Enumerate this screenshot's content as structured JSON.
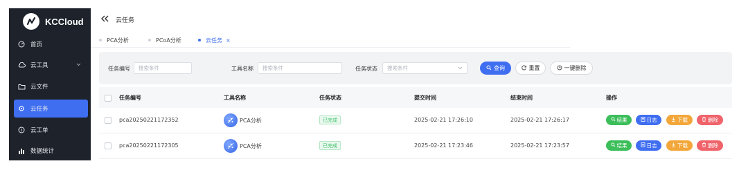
{
  "app": {
    "name": "KCCloud"
  },
  "sidebar": {
    "items": [
      {
        "label": "首页",
        "icon": "dashboard-icon",
        "active": false
      },
      {
        "label": "云工具",
        "icon": "cloud-icon",
        "active": false,
        "has_caret": true
      },
      {
        "label": "云文件",
        "icon": "folder-icon",
        "active": false
      },
      {
        "label": "云任务",
        "icon": "gear-icon",
        "active": true
      },
      {
        "label": "云工单",
        "icon": "info-icon",
        "active": false
      },
      {
        "label": "数据统计",
        "icon": "bar-chart-icon",
        "active": false
      }
    ]
  },
  "header": {
    "breadcrumb": "云任务",
    "collapse_icon": "double-chevron-left-icon"
  },
  "tabs": [
    {
      "label": "PCA分析",
      "active": false
    },
    {
      "label": "PCoA分析",
      "active": false
    },
    {
      "label": "云任务",
      "active": true,
      "close": "×"
    }
  ],
  "filters": {
    "task_id": {
      "label": "任务编号",
      "placeholder": "搜索条件"
    },
    "tool_name": {
      "label": "工具名称",
      "placeholder": "搜索条件"
    },
    "task_status": {
      "label": "任务状态",
      "placeholder": "搜索条件"
    },
    "search_button": "查询",
    "reset_button": "重置",
    "delete_all_button": "一键删除"
  },
  "table": {
    "columns": [
      "任务编号",
      "工具名称",
      "任务状态",
      "提交时间",
      "结束时间",
      "操作"
    ],
    "rows": [
      {
        "task_id": "pca20250221172352",
        "tool": "PCA分析",
        "status": "已完成",
        "submitted": "2025-02-21 17:26:10",
        "finished": "2025-02-21 17:26:17"
      },
      {
        "task_id": "pca20250221172305",
        "tool": "PCA分析",
        "status": "已完成",
        "submitted": "2025-02-21 17:23:46",
        "finished": "2025-02-21 17:23:57"
      }
    ],
    "actions": {
      "result": "结果",
      "log": "日志",
      "download": "下载",
      "delete": "删除"
    }
  },
  "colors": {
    "accent": "#3f6ef0",
    "sidebar_bg": "#1d222b",
    "success": "#3cbe5a",
    "warning": "#f3a73a",
    "danger": "#f0636a"
  }
}
